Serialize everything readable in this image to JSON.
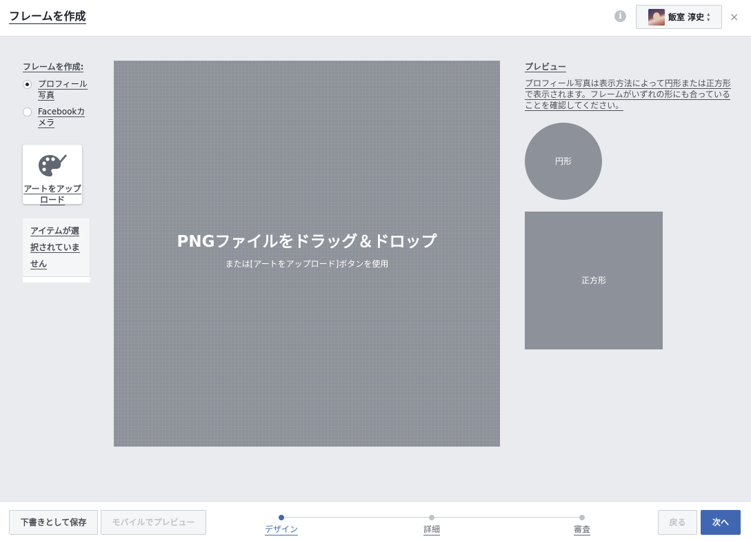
{
  "header": {
    "title": "フレームを作成",
    "info_icon": "info-icon",
    "account_name": "飯室 淳史",
    "sort_icon": "sort-icon",
    "close_glyph": "×"
  },
  "left_panel": {
    "title": "フレームを作成:",
    "options": [
      {
        "label": "プロフィール写真",
        "selected": true
      },
      {
        "label": "Facebookカメラ",
        "selected": false
      }
    ],
    "upload_label": "アートをアップロード",
    "upload_icon": "palette-icon",
    "items_empty_text": "アイテムが選択されていません"
  },
  "canvas": {
    "drop_title": "PNGファイルをドラッグ＆ドロップ",
    "drop_subtitle": "または[アートをアップロード]ボタンを使用"
  },
  "preview": {
    "title": "プレビュー",
    "description": "プロフィール写真は表示方法によって円形または正方形で表示されます。フレームがいずれの形にも合っていることを確認してください。",
    "circle_label": "円形",
    "square_label": "正方形"
  },
  "footer": {
    "save_draft": "下書きとして保存",
    "mobile_preview": "モバイルでプレビュー",
    "steps": [
      {
        "label": "デザイン",
        "active": true
      },
      {
        "label": "詳細",
        "active": false
      },
      {
        "label": "審査",
        "active": false
      }
    ],
    "back": "戻る",
    "next": "次へ"
  },
  "colors": {
    "background": "#e9ebee",
    "canvas": "#8d9199",
    "accent": "#4267b2"
  }
}
